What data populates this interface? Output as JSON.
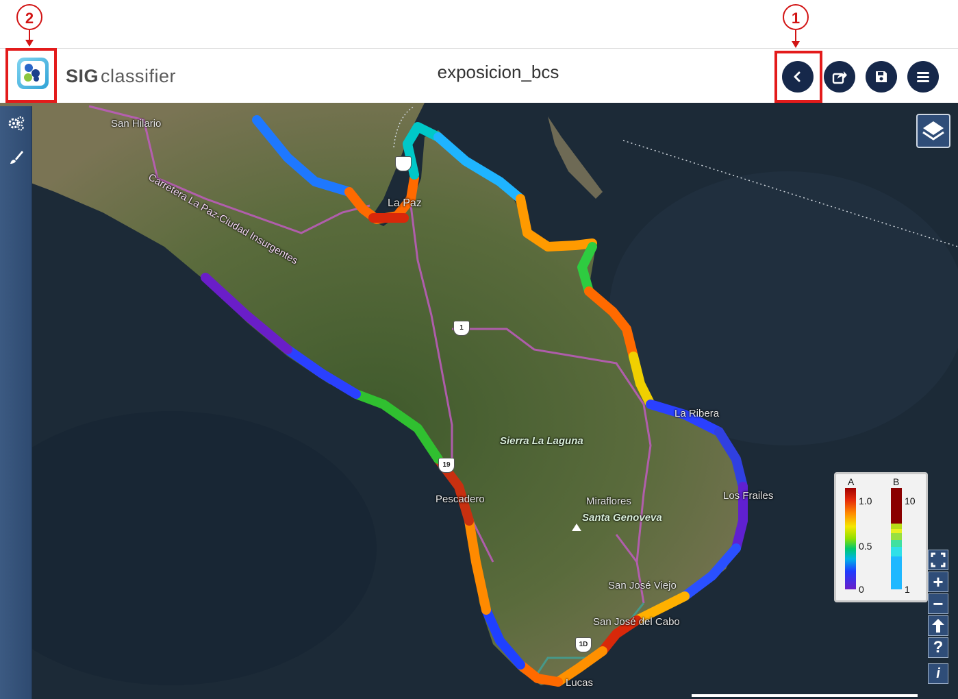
{
  "annotations": {
    "callout_1": "1",
    "callout_2": "2"
  },
  "header": {
    "app_name_bold": "SIG",
    "app_name_rest": "classifier",
    "map_title": "exposicion_bcs",
    "buttons": [
      "back-icon",
      "share-icon",
      "save-icon",
      "menu-icon"
    ]
  },
  "map": {
    "places": {
      "san_hilario": "San Hilario",
      "road_name": "Carretera La Paz-Ciudad Insurgentes",
      "la_paz": "La Paz",
      "sierra": "Sierra La Laguna",
      "miraflores": "Miraflores",
      "santa_genoveva": "Santa Genoveva",
      "pescadero": "Pescadero",
      "los_frailes": "Los Frailes",
      "san_jose_viejo": "San José Viejo",
      "san_jose_cabo": "San José del Cabo",
      "cabo_lucas": "Lucas",
      "la_ribera": "La Ribera"
    },
    "shields": {
      "hw_1": "1",
      "hw_19": "19",
      "hw_1d": "1D"
    }
  },
  "legend": {
    "a_title": "A",
    "a_max": "1.0",
    "a_mid": "0.5",
    "a_min": "0",
    "b_title": "B",
    "b_max": "10",
    "b_min": "1"
  },
  "colors": {
    "header_button_bg": "#16284a",
    "highlight_red": "#e31b1b",
    "toolbar_bg": "#2f4d78"
  },
  "tools": {
    "fullscreen": "fullscreen-icon",
    "zoom_in": "+",
    "zoom_out": "−",
    "home": "arrow-up-icon",
    "help": "?",
    "info": "i"
  }
}
